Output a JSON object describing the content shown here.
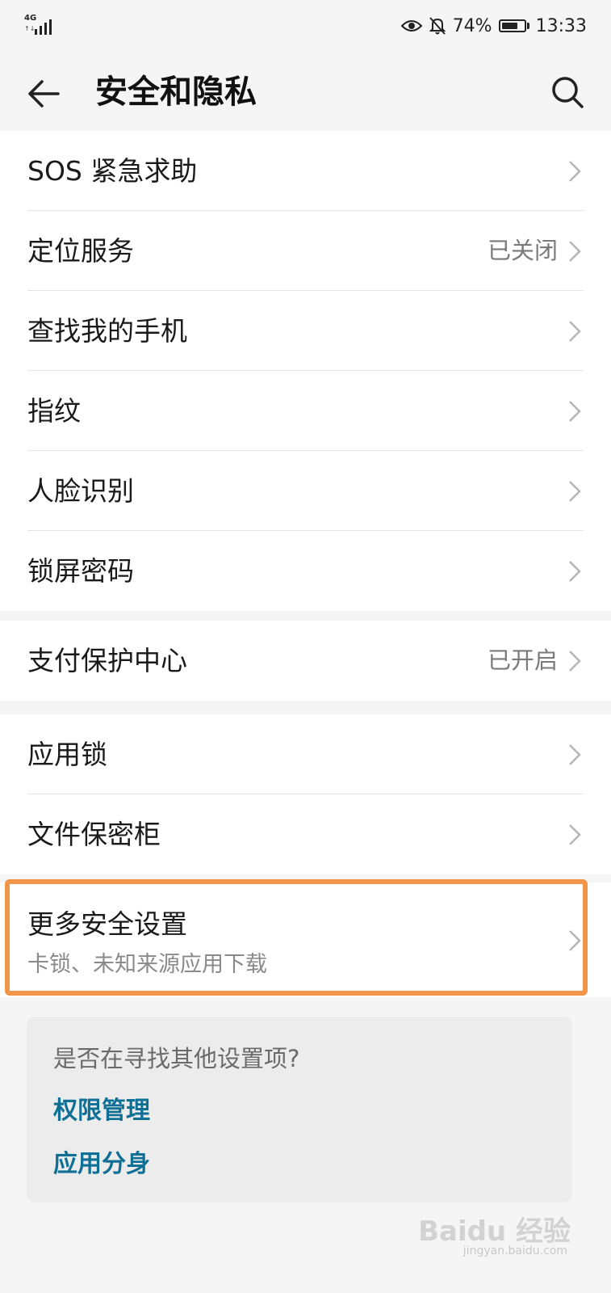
{
  "status": {
    "network": "4G",
    "arrows": "↑↓",
    "battery_percent_text": "74%",
    "battery_level": 0.74,
    "time": "13:33"
  },
  "appbar": {
    "title": "安全和隐私"
  },
  "groups": [
    {
      "items": [
        {
          "label": "SOS 紧急求助",
          "value": ""
        },
        {
          "label": "定位服务",
          "value": "已关闭"
        },
        {
          "label": "查找我的手机",
          "value": ""
        },
        {
          "label": "指纹",
          "value": ""
        },
        {
          "label": "人脸识别",
          "value": ""
        },
        {
          "label": "锁屏密码",
          "value": ""
        }
      ]
    },
    {
      "items": [
        {
          "label": "支付保护中心",
          "value": "已开启"
        }
      ]
    },
    {
      "items": [
        {
          "label": "应用锁",
          "value": ""
        },
        {
          "label": "文件保密柜",
          "value": ""
        }
      ]
    },
    {
      "items": [
        {
          "label": "更多安全设置",
          "subtitle": "卡锁、未知来源应用下载"
        }
      ]
    }
  ],
  "suggestion": {
    "title": "是否在寻找其他设置项?",
    "links": [
      "权限管理",
      "应用分身"
    ]
  },
  "watermark": {
    "main": "Baidu 经验",
    "sub": "jingyan.baidu.com"
  },
  "colors": {
    "link": "#0f6f95",
    "highlight": "#f0954a"
  }
}
